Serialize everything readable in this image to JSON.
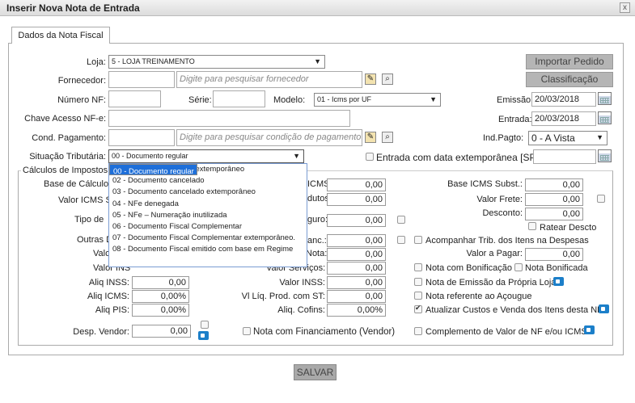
{
  "window": {
    "title": "Inserir Nova Nota de Entrada",
    "close_label": "x"
  },
  "tab": {
    "label": "Dados da Nota Fiscal"
  },
  "header": {
    "loja_label": "Loja:",
    "loja_value": "5 - LOJA TREINAMENTO",
    "importar_pedido": "Importar Pedido",
    "classificacao": "Classificação",
    "fornecedor_label": "Fornecedor:",
    "fornecedor_placeholder": "Digite para pesquisar fornecedor",
    "numero_nf_label": "Número NF:",
    "serie_label": "Série:",
    "modelo_label": "Modelo:",
    "modelo_value": "01 - Icms por UF",
    "emissao_label": "Emissão:",
    "emissao_value": "20/03/2018",
    "chave_label": "Chave Acesso NF-e:",
    "entrada_label": "Entrada:",
    "entrada_value": "20/03/2018",
    "cond_label": "Cond. Pagamento:",
    "cond_placeholder": "Digite para pesquisar condição de pagamento",
    "indpagto_label": "Ind.Pagto:",
    "indpagto_value": "0 - A Vista",
    "situacao_label": "Situação Tributária:",
    "situacao_value": "00 - Documento regular",
    "extemporanea_label": "Entrada com data extemporânea [SPED]"
  },
  "dropdown": {
    "options": [
      "00 - Documento regular",
      "01 - Documento regular extemporâneo",
      "02 - Documento cancelado",
      "03 - Documento cancelado extemporâneo",
      "04 - NFe denegada",
      "05 - NFe – Numeração inutilizada",
      "06 - Documento Fiscal Complementar",
      "07 - Documento Fiscal Complementar extemporâneo.",
      "08 - Documento Fiscal emitido com base em Regime"
    ]
  },
  "calc": {
    "legend": "Cálculos de Impostos",
    "base_calculo_label": "Base de Cálculo",
    "valor_icms_s_label": "Valor ICMS S",
    "tipo_de_label": "Tipo de",
    "outras_label": "Outras D",
    "valo_label1": "Valo",
    "valor_ins_label": "Valor INS",
    "icms_frag": "ICMS:",
    "icms_val": "0,00",
    "produtos_frag": "dutos:",
    "produtos_val": "0,00",
    "seguro_frag": "guro:",
    "seguro_val": "0,00",
    "financ_frag": "anc.:",
    "financ_val": "0,00",
    "nota_frag": "Nota:",
    "nota_val": "0,00",
    "servicos_frag": "Valor Serviços:",
    "servicos_val": "0,00",
    "aliq_inss_label": "Aliq INSS:",
    "aliq_inss_val": "0,00",
    "valor_inss_label": "Valor INSS:",
    "valor_inss_val": "0,00",
    "aliq_icms_label": "Aliq ICMS:",
    "aliq_icms_val": "0,00%",
    "vl_liq_label": "Vl Líq. Prod. com ST:",
    "vl_liq_val": "0,00",
    "aliq_pis_label": "Aliq PIS:",
    "aliq_pis_val": "0,00%",
    "aliq_cofins_label": "Aliq. Cofins:",
    "aliq_cofins_val": "0,00%",
    "desp_vendor_label": "Desp. Vendor:",
    "desp_vendor_val": "0,00",
    "financiamento_label": "Nota com Financiamento (Vendor)",
    "base_icms_subst_label": "Base ICMS Subst.:",
    "base_icms_subst_val": "0,00",
    "valor_frete_label": "Valor Frete:",
    "valor_frete_val": "0,00",
    "desconto_label": "Desconto:",
    "desconto_val": "0,00",
    "ratear_label": "Ratear Descto",
    "acompanhar_label": "Acompanhar Trib. dos Itens na Despesas",
    "valor_pagar_label": "Valor a Pagar:",
    "valor_pagar_val": "0,00",
    "bonificacao_label": "Nota com Bonificação",
    "nota_bonificada_label": "Nota Bonificada",
    "emissao_propria_label": "Nota de Emissão da Própria Loja",
    "acougue_label": "Nota referente ao Açougue",
    "atualizar_label": "Atualizar Custos e Venda dos Itens desta NF",
    "complemento_label": "Complemento de Valor de NF e/ou ICMS"
  },
  "footer": {
    "salvar": "SALVAR"
  }
}
